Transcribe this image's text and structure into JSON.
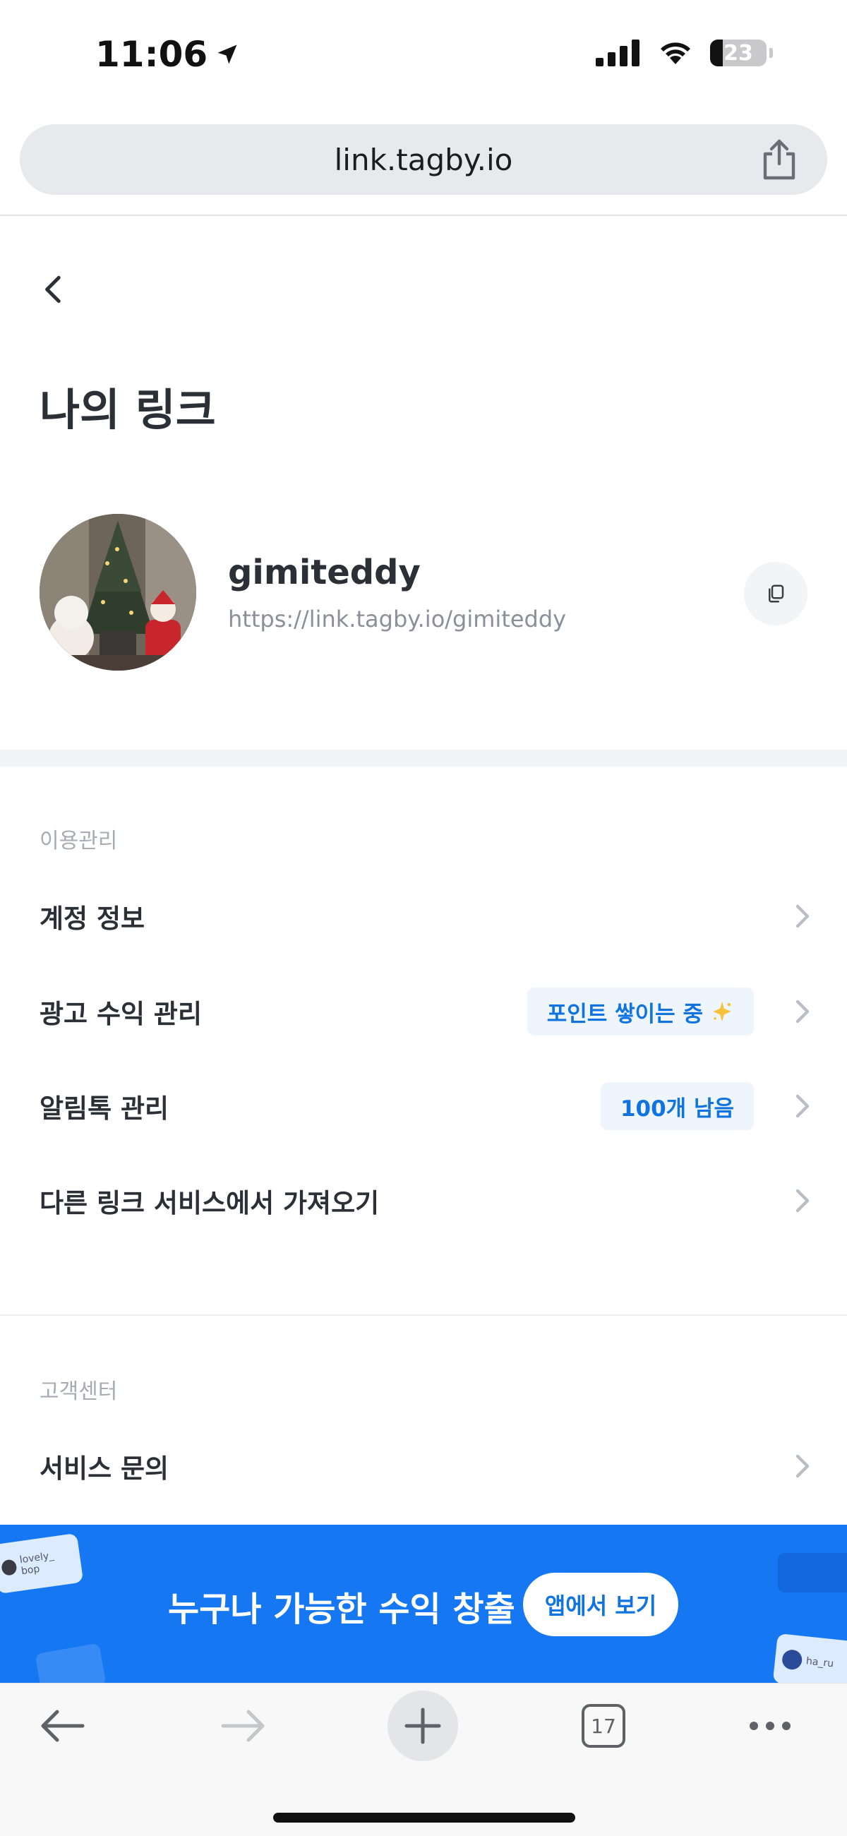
{
  "status_bar": {
    "time": "11:06",
    "battery_level": "23",
    "battery_fraction": 0.23
  },
  "browser": {
    "url": "link.tagby.io",
    "tab_count": "17"
  },
  "page": {
    "title": "나의 링크"
  },
  "profile": {
    "username": "gimiteddy",
    "url": "https://link.tagby.io/gimiteddy"
  },
  "sections": [
    {
      "label": "이용관리",
      "items": [
        {
          "label": "계정 정보"
        },
        {
          "label": "광고 수익 관리",
          "badge": "포인트 쌓이는 중"
        },
        {
          "label": "알림톡 관리",
          "badge": "100개 남음"
        },
        {
          "label": "다른 링크 서비스에서 가져오기"
        }
      ]
    },
    {
      "label": "고객센터",
      "items": [
        {
          "label": "서비스 문의"
        }
      ]
    }
  ],
  "promo": {
    "text": "누구나 가능한 수익 창출",
    "button": "앱에서 보기",
    "deco_card_1": "lovely_ bop",
    "deco_card_2": "ha_ru"
  },
  "icons": {
    "location": "location-arrow-icon",
    "share": "share-icon",
    "back": "chevron-left-icon",
    "copy": "copy-icon",
    "chevron": "chevron-right-icon",
    "sparkle": "sparkle-icon"
  },
  "colors": {
    "accent": "#1677f2",
    "badge_bg": "#eef5fd",
    "badge_text": "#1173e0",
    "title_text": "#2b2f36",
    "muted_text": "#8a8f98"
  }
}
